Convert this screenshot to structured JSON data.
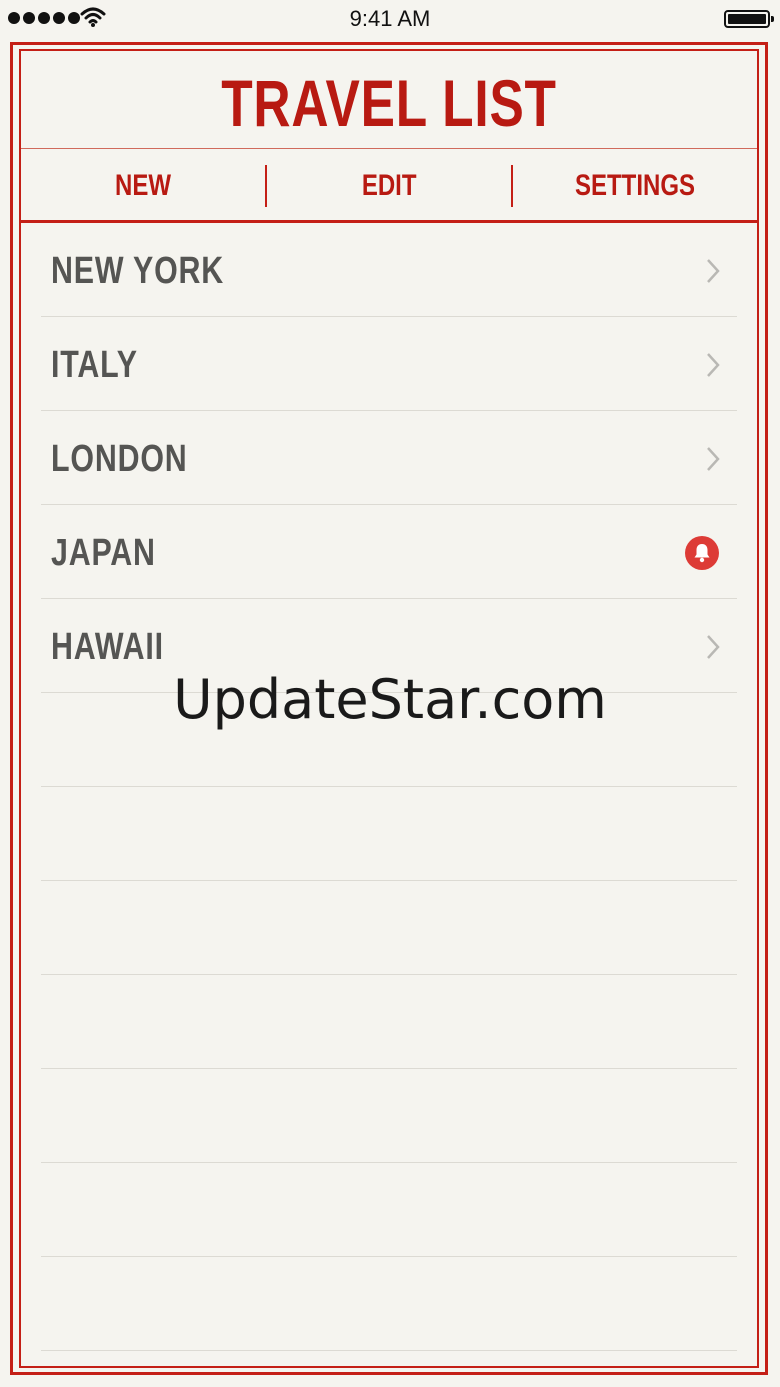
{
  "status_bar": {
    "time": "9:41 AM",
    "signal_icon": "signal-dots-icon",
    "wifi_icon": "wifi-icon",
    "battery_icon": "battery-icon"
  },
  "app": {
    "title": "TRAVEL LIST",
    "accent_color": "#c41f16"
  },
  "toolbar": {
    "new_label": "NEW",
    "edit_label": "EDIT",
    "settings_label": "SETTINGS"
  },
  "list": {
    "items": [
      {
        "label": "NEW YORK",
        "icon": "chevron-right-icon"
      },
      {
        "label": "ITALY",
        "icon": "chevron-right-icon"
      },
      {
        "label": "LONDON",
        "icon": "chevron-right-icon"
      },
      {
        "label": "JAPAN",
        "icon": "bell-icon"
      },
      {
        "label": "HAWAII",
        "icon": "chevron-right-icon"
      }
    ]
  },
  "watermark": "UpdateStar.com"
}
